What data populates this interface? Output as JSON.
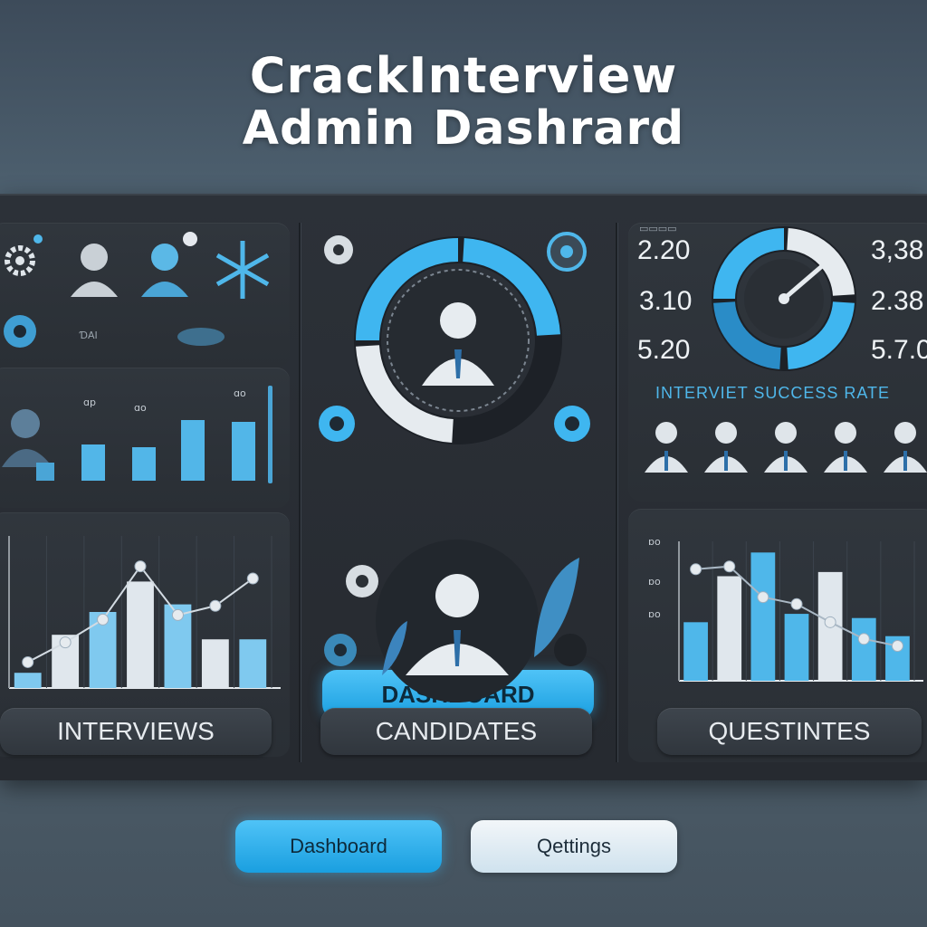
{
  "header": {
    "title_line1": "CrackInterview",
    "title_line2": "Admin Dashrard"
  },
  "left_panel": {
    "top_chart_labels": [
      "ɑp",
      "ɑo",
      "ɑo"
    ],
    "icon_caption": "ƊAI",
    "interviews_label": "INTERVIEWS",
    "line_chart": {
      "bars": [
        0.1,
        0.35,
        0.5,
        0.7,
        0.55,
        0.32,
        0.32
      ],
      "line": [
        0.17,
        0.3,
        0.45,
        0.8,
        0.48,
        0.54,
        0.72
      ]
    }
  },
  "center_panel": {
    "dashboard_label": "DASHBOARD",
    "candidates_label": "CANDIDATES"
  },
  "right_panel": {
    "stats_left": [
      "2.20",
      "3.10",
      "5.20"
    ],
    "stats_right": [
      "3,38",
      "2.38",
      "5.7.0"
    ],
    "success_rate_label": "INTERVIET SUCCESS RATE",
    "axis_ticks": [
      "ɒo",
      "ɒo",
      "ɒo"
    ],
    "questions_label": "QUESTINTES",
    "gauge_value": 0.62,
    "bar_chart": {
      "bars": [
        0.42,
        0.75,
        0.92,
        0.48,
        0.78,
        0.45,
        0.32
      ],
      "line": [
        0.8,
        0.82,
        0.6,
        0.55,
        0.42,
        0.3,
        0.25
      ]
    }
  },
  "bottom_nav": {
    "dashboard_label": "Dashboard",
    "settings_label": "Qettings"
  },
  "colors": {
    "accent": "#3fb6f0",
    "panel": "#2c3138",
    "background": "#4e6170"
  }
}
